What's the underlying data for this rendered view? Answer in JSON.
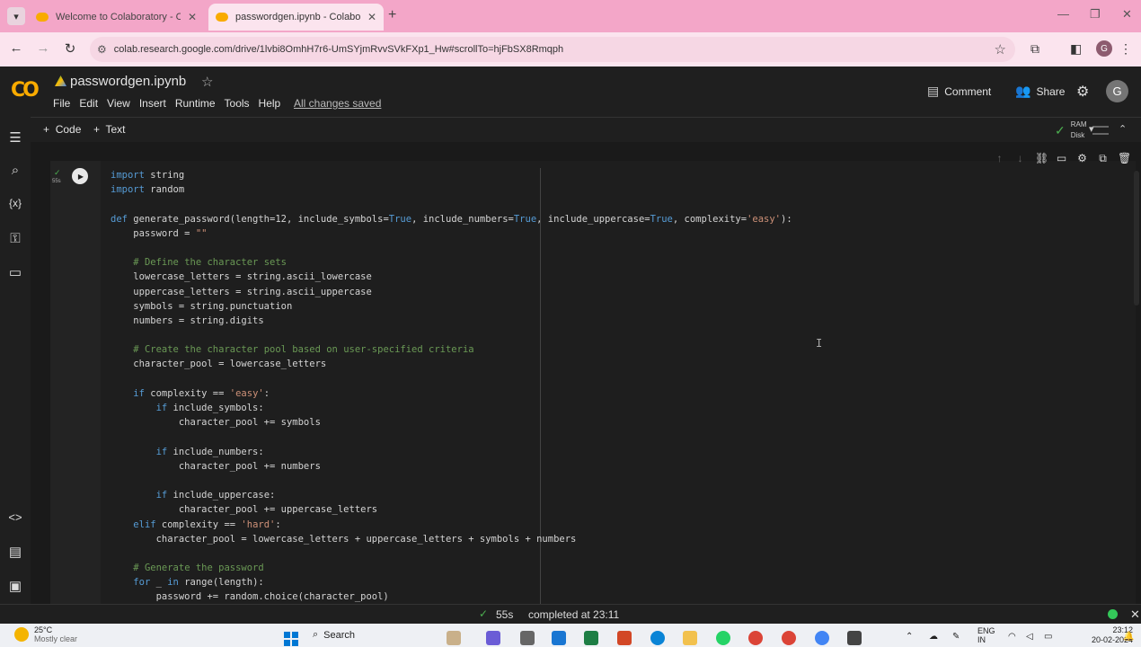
{
  "browser": {
    "tabs": [
      {
        "title": "Welcome to Colaboratory - Co",
        "active": false
      },
      {
        "title": "passwordgen.ipynb - Colabora",
        "active": true
      }
    ],
    "url": "colab.research.google.com/drive/1lvbi8OmhH7r6-UmSYjmRvvSVkFXp1_Hw#scrollTo=hjFbSX8Rmqph",
    "profile_initial": "G"
  },
  "colab": {
    "notebook_title": "passwordgen.ipynb",
    "menu": [
      "File",
      "Edit",
      "View",
      "Insert",
      "Runtime",
      "Tools",
      "Help"
    ],
    "save_status": "All changes saved",
    "comment_label": "Comment",
    "share_label": "Share",
    "avatar_initial": "G",
    "add_code_label": "Code",
    "add_text_label": "Text",
    "ram_label": "RAM",
    "disk_label": "Disk"
  },
  "cell": {
    "exec_time": "55s",
    "code_lines": [
      [
        {
          "t": "import",
          "c": "kw"
        },
        {
          "t": " string"
        }
      ],
      [
        {
          "t": "import",
          "c": "kw"
        },
        {
          "t": " random"
        }
      ],
      [],
      [
        {
          "t": "def",
          "c": "kw"
        },
        {
          "t": " generate_password(length=12, include_symbols="
        },
        {
          "t": "True",
          "c": "kw"
        },
        {
          "t": ", include_numbers="
        },
        {
          "t": "True",
          "c": "kw"
        },
        {
          "t": ", include_uppercase="
        },
        {
          "t": "True",
          "c": "kw"
        },
        {
          "t": ", complexity="
        },
        {
          "t": "'easy'",
          "c": "st"
        },
        {
          "t": "):"
        }
      ],
      [
        {
          "t": "    password = "
        },
        {
          "t": "\"\"",
          "c": "st"
        }
      ],
      [],
      [
        {
          "t": "    "
        },
        {
          "t": "# Define the character sets",
          "c": "cm"
        }
      ],
      [
        {
          "t": "    lowercase_letters = string.ascii_lowercase"
        }
      ],
      [
        {
          "t": "    uppercase_letters = string.ascii_uppercase"
        }
      ],
      [
        {
          "t": "    symbols = string.punctuation"
        }
      ],
      [
        {
          "t": "    numbers = string.digits"
        }
      ],
      [],
      [
        {
          "t": "    "
        },
        {
          "t": "# Create the character pool based on user-specified criteria",
          "c": "cm"
        }
      ],
      [
        {
          "t": "    character_pool = lowercase_letters"
        }
      ],
      [],
      [
        {
          "t": "    "
        },
        {
          "t": "if",
          "c": "kw"
        },
        {
          "t": " complexity == "
        },
        {
          "t": "'easy'",
          "c": "st"
        },
        {
          "t": ":"
        }
      ],
      [
        {
          "t": "        "
        },
        {
          "t": "if",
          "c": "kw"
        },
        {
          "t": " include_symbols:"
        }
      ],
      [
        {
          "t": "            character_pool += symbols"
        }
      ],
      [],
      [
        {
          "t": "        "
        },
        {
          "t": "if",
          "c": "kw"
        },
        {
          "t": " include_numbers:"
        }
      ],
      [
        {
          "t": "            character_pool += numbers"
        }
      ],
      [],
      [
        {
          "t": "        "
        },
        {
          "t": "if",
          "c": "kw"
        },
        {
          "t": " include_uppercase:"
        }
      ],
      [
        {
          "t": "            character_pool += uppercase_letters"
        }
      ],
      [
        {
          "t": "    "
        },
        {
          "t": "elif",
          "c": "kw"
        },
        {
          "t": " complexity == "
        },
        {
          "t": "'hard'",
          "c": "st"
        },
        {
          "t": ":"
        }
      ],
      [
        {
          "t": "        character_pool = lowercase_letters + uppercase_letters + symbols + numbers"
        }
      ],
      [],
      [
        {
          "t": "    "
        },
        {
          "t": "# Generate the password",
          "c": "cm"
        }
      ],
      [
        {
          "t": "    "
        },
        {
          "t": "for",
          "c": "kw"
        },
        {
          "t": " _ "
        },
        {
          "t": "in",
          "c": "kw"
        },
        {
          "t": " range(length):"
        }
      ],
      [
        {
          "t": "        password += random.choice(character_pool)"
        }
      ]
    ]
  },
  "status": {
    "exec_time": "55s",
    "message": "completed at 23:11"
  },
  "taskbar": {
    "temperature": "25°C",
    "weather_sub": "Mostly clear",
    "search_label": "Search",
    "lang": "ENG",
    "lang_sub": "IN",
    "time": "23:12",
    "date": "20-02-2024"
  },
  "colors": {
    "accent_orange": "#f9ab00",
    "success_green": "#4caf50",
    "tab_pink": "#f3a6c8"
  }
}
